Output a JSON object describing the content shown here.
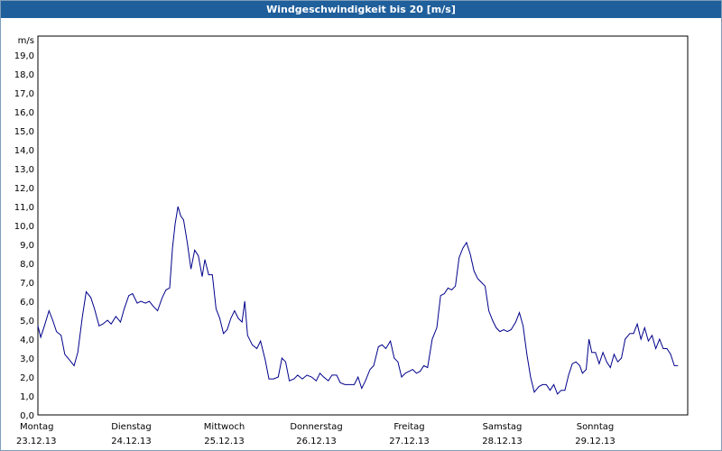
{
  "window": {
    "title": "Windgeschwindigkeit bis 20 [m/s]"
  },
  "colors": {
    "title_bar": "#1f5f9c",
    "line": "#00008b",
    "grid": "#000000"
  },
  "chart_data": {
    "type": "line",
    "title": "Windgeschwindigkeit bis 20 [m/s]",
    "ylabel": "m/s",
    "ylim": [
      0,
      20
    ],
    "yticks": [
      "0,0",
      "1,0",
      "2,0",
      "3,0",
      "4,0",
      "5,0",
      "6,0",
      "7,0",
      "8,0",
      "9,0",
      "10,0",
      "11,0",
      "12,0",
      "13,0",
      "14,0",
      "15,0",
      "16,0",
      "17,0",
      "18,0",
      "19,0"
    ],
    "grid": true,
    "xlim_days": [
      0,
      7
    ],
    "days": [
      {
        "day": "Montag",
        "date": "23.12.13"
      },
      {
        "day": "Dienstag",
        "date": "24.12.13"
      },
      {
        "day": "Mittwoch",
        "date": "25.12.13"
      },
      {
        "day": "Donnerstag",
        "date": "26.12.13"
      },
      {
        "day": "Freitag",
        "date": "27.12.13"
      },
      {
        "day": "Samstag",
        "date": "28.12.13"
      },
      {
        "day": "Sonntag",
        "date": "29.12.13"
      }
    ],
    "series": [
      {
        "points": [
          [
            0.0,
            4.7
          ],
          [
            0.03,
            4.1
          ],
          [
            0.07,
            4.7
          ],
          [
            0.12,
            5.5
          ],
          [
            0.16,
            5.0
          ],
          [
            0.2,
            4.4
          ],
          [
            0.25,
            4.2
          ],
          [
            0.29,
            3.2
          ],
          [
            0.34,
            2.9
          ],
          [
            0.39,
            2.6
          ],
          [
            0.43,
            3.3
          ],
          [
            0.48,
            5.2
          ],
          [
            0.52,
            6.5
          ],
          [
            0.57,
            6.2
          ],
          [
            0.61,
            5.6
          ],
          [
            0.66,
            4.7
          ],
          [
            0.7,
            4.8
          ],
          [
            0.75,
            5.0
          ],
          [
            0.79,
            4.8
          ],
          [
            0.84,
            5.2
          ],
          [
            0.89,
            4.9
          ],
          [
            0.93,
            5.6
          ],
          [
            0.98,
            6.3
          ],
          [
            1.02,
            6.4
          ],
          [
            1.07,
            5.9
          ],
          [
            1.11,
            6.0
          ],
          [
            1.16,
            5.9
          ],
          [
            1.2,
            6.0
          ],
          [
            1.25,
            5.7
          ],
          [
            1.29,
            5.5
          ],
          [
            1.34,
            6.2
          ],
          [
            1.38,
            6.6
          ],
          [
            1.42,
            6.7
          ],
          [
            1.45,
            8.8
          ],
          [
            1.48,
            10.1
          ],
          [
            1.51,
            11.0
          ],
          [
            1.54,
            10.5
          ],
          [
            1.57,
            10.3
          ],
          [
            1.61,
            9.1
          ],
          [
            1.65,
            7.7
          ],
          [
            1.69,
            8.7
          ],
          [
            1.73,
            8.4
          ],
          [
            1.77,
            7.3
          ],
          [
            1.8,
            8.2
          ],
          [
            1.84,
            7.4
          ],
          [
            1.88,
            7.4
          ],
          [
            1.92,
            5.6
          ],
          [
            1.96,
            5.1
          ],
          [
            2.0,
            4.3
          ],
          [
            2.04,
            4.5
          ],
          [
            2.08,
            5.1
          ],
          [
            2.12,
            5.5
          ],
          [
            2.16,
            5.1
          ],
          [
            2.2,
            4.9
          ],
          [
            2.23,
            6.0
          ],
          [
            2.26,
            4.2
          ],
          [
            2.31,
            3.7
          ],
          [
            2.36,
            3.5
          ],
          [
            2.4,
            3.9
          ],
          [
            2.45,
            2.9
          ],
          [
            2.49,
            1.9
          ],
          [
            2.54,
            1.9
          ],
          [
            2.59,
            2.0
          ],
          [
            2.63,
            3.0
          ],
          [
            2.67,
            2.8
          ],
          [
            2.71,
            1.8
          ],
          [
            2.76,
            1.9
          ],
          [
            2.8,
            2.1
          ],
          [
            2.85,
            1.9
          ],
          [
            2.9,
            2.1
          ],
          [
            2.95,
            2.0
          ],
          [
            3.0,
            1.8
          ],
          [
            3.04,
            2.2
          ],
          [
            3.08,
            2.0
          ],
          [
            3.13,
            1.8
          ],
          [
            3.17,
            2.1
          ],
          [
            3.22,
            2.1
          ],
          [
            3.26,
            1.7
          ],
          [
            3.31,
            1.6
          ],
          [
            3.36,
            1.6
          ],
          [
            3.41,
            1.6
          ],
          [
            3.45,
            2.0
          ],
          [
            3.49,
            1.4
          ],
          [
            3.53,
            1.8
          ],
          [
            3.58,
            2.4
          ],
          [
            3.62,
            2.6
          ],
          [
            3.67,
            3.6
          ],
          [
            3.71,
            3.7
          ],
          [
            3.75,
            3.5
          ],
          [
            3.8,
            3.9
          ],
          [
            3.84,
            3.0
          ],
          [
            3.88,
            2.8
          ],
          [
            3.92,
            2.0
          ],
          [
            3.96,
            2.2
          ],
          [
            4.0,
            2.3
          ],
          [
            4.04,
            2.4
          ],
          [
            4.08,
            2.2
          ],
          [
            4.12,
            2.3
          ],
          [
            4.16,
            2.6
          ],
          [
            4.2,
            2.5
          ],
          [
            4.25,
            4.0
          ],
          [
            4.3,
            4.6
          ],
          [
            4.34,
            6.3
          ],
          [
            4.38,
            6.4
          ],
          [
            4.42,
            6.7
          ],
          [
            4.46,
            6.6
          ],
          [
            4.5,
            6.8
          ],
          [
            4.54,
            8.3
          ],
          [
            4.58,
            8.8
          ],
          [
            4.62,
            9.1
          ],
          [
            4.66,
            8.5
          ],
          [
            4.7,
            7.6
          ],
          [
            4.74,
            7.2
          ],
          [
            4.78,
            7.0
          ],
          [
            4.82,
            6.8
          ],
          [
            4.86,
            5.5
          ],
          [
            4.9,
            5.0
          ],
          [
            4.94,
            4.6
          ],
          [
            4.98,
            4.4
          ],
          [
            5.02,
            4.5
          ],
          [
            5.06,
            4.4
          ],
          [
            5.1,
            4.5
          ],
          [
            5.15,
            4.9
          ],
          [
            5.19,
            5.4
          ],
          [
            5.23,
            4.7
          ],
          [
            5.27,
            3.2
          ],
          [
            5.31,
            2.0
          ],
          [
            5.35,
            1.2
          ],
          [
            5.4,
            1.5
          ],
          [
            5.44,
            1.6
          ],
          [
            5.48,
            1.6
          ],
          [
            5.52,
            1.3
          ],
          [
            5.56,
            1.6
          ],
          [
            5.6,
            1.1
          ],
          [
            5.64,
            1.3
          ],
          [
            5.68,
            1.3
          ],
          [
            5.72,
            2.1
          ],
          [
            5.76,
            2.7
          ],
          [
            5.8,
            2.8
          ],
          [
            5.84,
            2.6
          ],
          [
            5.87,
            2.2
          ],
          [
            5.91,
            2.4
          ],
          [
            5.94,
            4.0
          ],
          [
            5.97,
            3.3
          ],
          [
            6.01,
            3.3
          ],
          [
            6.05,
            2.7
          ],
          [
            6.09,
            3.3
          ],
          [
            6.13,
            2.8
          ],
          [
            6.17,
            2.5
          ],
          [
            6.21,
            3.2
          ],
          [
            6.25,
            2.8
          ],
          [
            6.29,
            3.0
          ],
          [
            6.33,
            4.0
          ],
          [
            6.38,
            4.3
          ],
          [
            6.42,
            4.3
          ],
          [
            6.46,
            4.8
          ],
          [
            6.5,
            4.0
          ],
          [
            6.54,
            4.6
          ],
          [
            6.58,
            3.9
          ],
          [
            6.62,
            4.2
          ],
          [
            6.66,
            3.5
          ],
          [
            6.7,
            4.0
          ],
          [
            6.74,
            3.5
          ],
          [
            6.78,
            3.5
          ],
          [
            6.82,
            3.2
          ],
          [
            6.86,
            2.6
          ],
          [
            6.9,
            2.6
          ]
        ]
      }
    ]
  }
}
